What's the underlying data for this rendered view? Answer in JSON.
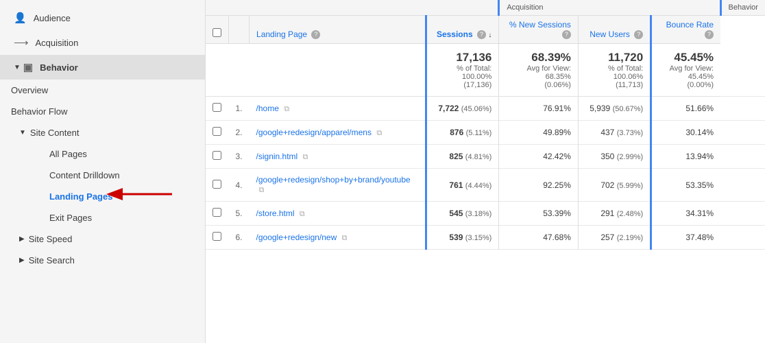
{
  "sidebar": {
    "items": [
      {
        "id": "audience",
        "label": "Audience",
        "icon": "👤",
        "level": 0
      },
      {
        "id": "acquisition",
        "label": "Acquisition",
        "icon": "⟶",
        "level": 0
      },
      {
        "id": "behavior",
        "label": "Behavior",
        "icon": "▣",
        "level": 0,
        "active": true
      },
      {
        "id": "overview",
        "label": "Overview",
        "level": 1
      },
      {
        "id": "behavior-flow",
        "label": "Behavior Flow",
        "level": 1
      },
      {
        "id": "site-content",
        "label": "Site Content",
        "level": 1,
        "expandable": true
      },
      {
        "id": "all-pages",
        "label": "All Pages",
        "level": 2
      },
      {
        "id": "content-drilldown",
        "label": "Content Drilldown",
        "level": 2
      },
      {
        "id": "landing-pages",
        "label": "Landing Pages",
        "level": 2,
        "active": true
      },
      {
        "id": "exit-pages",
        "label": "Exit Pages",
        "level": 2
      },
      {
        "id": "site-speed",
        "label": "Site Speed",
        "level": 1,
        "expandable": true
      },
      {
        "id": "site-search",
        "label": "Site Search",
        "level": 1,
        "expandable": true
      }
    ]
  },
  "table": {
    "groups": [
      {
        "label": "",
        "colspan": 4
      },
      {
        "label": "Acquisition",
        "colspan": 3
      },
      {
        "label": "Behavior",
        "colspan": 1
      }
    ],
    "headers": [
      {
        "id": "checkbox",
        "label": "",
        "type": "checkbox"
      },
      {
        "id": "num",
        "label": "",
        "type": "num"
      },
      {
        "id": "landing-page",
        "label": "Landing Page",
        "help": true
      },
      {
        "id": "sessions",
        "label": "Sessions",
        "help": true,
        "sort": true,
        "sort_dir": "desc"
      },
      {
        "id": "new-sessions",
        "label": "% New Sessions",
        "help": true
      },
      {
        "id": "new-users",
        "label": "New Users",
        "help": true
      },
      {
        "id": "bounce-rate",
        "label": "Bounce Rate",
        "help": true
      }
    ],
    "totals": {
      "sessions_val": "17,136",
      "sessions_pct": "% of Total: 100.00%",
      "sessions_sub": "(17,136)",
      "new_sessions_val": "68.39%",
      "new_sessions_sub1": "Avg for View:",
      "new_sessions_sub2": "68.35%",
      "new_sessions_sub3": "(0.06%)",
      "new_users_val": "11,720",
      "new_users_pct": "% of Total: 100.06%",
      "new_users_sub": "(11,713)",
      "bounce_rate_val": "45.45%",
      "bounce_rate_sub1": "Avg for View:",
      "bounce_rate_sub2": "45.45%",
      "bounce_rate_sub3": "(0.00%)"
    },
    "rows": [
      {
        "num": "1.",
        "page": "/home",
        "sessions": "7,722",
        "sessions_pct": "(45.06%)",
        "new_sessions": "76.91%",
        "new_users": "5,939",
        "new_users_pct": "(50.67%)",
        "bounce_rate": "51.66%"
      },
      {
        "num": "2.",
        "page": "/google+redesign/apparel/mens",
        "sessions": "876",
        "sessions_pct": "(5.11%)",
        "new_sessions": "49.89%",
        "new_users": "437",
        "new_users_pct": "(3.73%)",
        "bounce_rate": "30.14%"
      },
      {
        "num": "3.",
        "page": "/signin.html",
        "sessions": "825",
        "sessions_pct": "(4.81%)",
        "new_sessions": "42.42%",
        "new_users": "350",
        "new_users_pct": "(2.99%)",
        "bounce_rate": "13.94%"
      },
      {
        "num": "4.",
        "page": "/google+redesign/shop+by+brand/youtube",
        "sessions": "761",
        "sessions_pct": "(4.44%)",
        "new_sessions": "92.25%",
        "new_users": "702",
        "new_users_pct": "(5.99%)",
        "bounce_rate": "53.35%"
      },
      {
        "num": "5.",
        "page": "/store.html",
        "sessions": "545",
        "sessions_pct": "(3.18%)",
        "new_sessions": "53.39%",
        "new_users": "291",
        "new_users_pct": "(2.48%)",
        "bounce_rate": "34.31%"
      },
      {
        "num": "6.",
        "page": "/google+redesign/new",
        "sessions": "539",
        "sessions_pct": "(3.15%)",
        "new_sessions": "47.68%",
        "new_users": "257",
        "new_users_pct": "(2.19%)",
        "bounce_rate": "37.48%"
      }
    ]
  }
}
